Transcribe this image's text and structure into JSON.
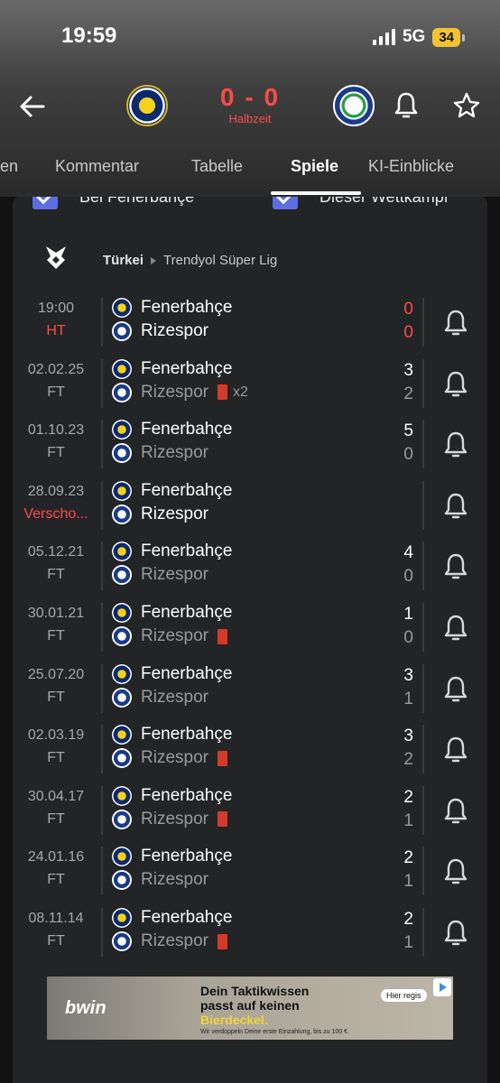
{
  "status_bar": {
    "time": "19:59",
    "network": "5G",
    "battery": "34"
  },
  "match": {
    "home_score": "0",
    "away_score": "0",
    "score_sep": "-",
    "period": "Halbzeit"
  },
  "tabs": [
    {
      "label": "en"
    },
    {
      "label": "Kommentar"
    },
    {
      "label": "Tabelle"
    },
    {
      "label": "Spiele",
      "active": true
    },
    {
      "label": "KI-Einblicke"
    }
  ],
  "filters": {
    "home_label": "Bei Fenerbahçe",
    "competition_label": "Dieser Wettkampf"
  },
  "league": {
    "country": "Türkei",
    "name": "Trendyol Süper Lig"
  },
  "matches": [
    {
      "date": "19:00",
      "status": "HT",
      "home": "Fenerbahçe",
      "away": "Rizespor",
      "home_score": "0",
      "away_score": "0",
      "away_red": ""
    },
    {
      "date": "02.02.25",
      "status": "FT",
      "home": "Fenerbahçe",
      "away": "Rizespor",
      "home_score": "3",
      "away_score": "2",
      "away_red": "x2"
    },
    {
      "date": "01.10.23",
      "status": "FT",
      "home": "Fenerbahçe",
      "away": "Rizespor",
      "home_score": "5",
      "away_score": "0",
      "away_red": ""
    },
    {
      "date": "28.09.23",
      "status": "Verscho...",
      "home": "Fenerbahçe",
      "away": "Rizespor",
      "home_score": "",
      "away_score": "",
      "away_red": ""
    },
    {
      "date": "05.12.21",
      "status": "FT",
      "home": "Fenerbahçe",
      "away": "Rizespor",
      "home_score": "4",
      "away_score": "0",
      "away_red": ""
    },
    {
      "date": "30.01.21",
      "status": "FT",
      "home": "Fenerbahçe",
      "away": "Rizespor",
      "home_score": "1",
      "away_score": "0",
      "away_red": "1"
    },
    {
      "date": "25.07.20",
      "status": "FT",
      "home": "Fenerbahçe",
      "away": "Rizespor",
      "home_score": "3",
      "away_score": "1",
      "away_red": ""
    },
    {
      "date": "02.03.19",
      "status": "FT",
      "home": "Fenerbahçe",
      "away": "Rizespor",
      "home_score": "3",
      "away_score": "2",
      "away_red": "1"
    },
    {
      "date": "30.04.17",
      "status": "FT",
      "home": "Fenerbahçe",
      "away": "Rizespor",
      "home_score": "2",
      "away_score": "1",
      "away_red": "1"
    },
    {
      "date": "24.01.16",
      "status": "FT",
      "home": "Fenerbahçe",
      "away": "Rizespor",
      "home_score": "2",
      "away_score": "1",
      "away_red": ""
    },
    {
      "date": "08.11.14",
      "status": "FT",
      "home": "Fenerbahçe",
      "away": "Rizespor",
      "home_score": "2",
      "away_score": "1",
      "away_red": "1"
    }
  ],
  "ad": {
    "brand": "bwin",
    "line1": "Dein Taktikwissen",
    "line2": "passt auf keinen",
    "line3": "Bierdeckel.",
    "fine_print": "Wir verdoppeln Deine erste Einzahlung, bis zu 100 €.",
    "cta": "Hier regis"
  },
  "colors": {
    "live_red": "#ff4a4a",
    "checkbox_blue": "#5b6fe0",
    "red_card": "#d43a2a",
    "card_bg": "#232426"
  }
}
